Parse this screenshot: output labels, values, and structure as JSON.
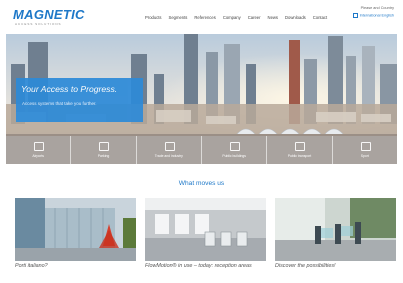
{
  "logo": {
    "text": "MAGNETIC",
    "tagline": "ACCESS SOLUTIONS"
  },
  "nav": [
    "Products",
    "Segments",
    "References",
    "Company",
    "Career",
    "News",
    "Downloads",
    "Contact"
  ],
  "utility": {
    "search_contact": "Please and Country",
    "language": "International English"
  },
  "hero": {
    "headline": "Your Access to Progress.",
    "subline": "Access systems that take you further."
  },
  "categories": [
    "Airports",
    "Parking",
    "Trade and industry",
    "Public buildings",
    "Public transport",
    "Sport"
  ],
  "section_title": "What moves us",
  "cards": [
    {
      "caption": "Porti italiano?"
    },
    {
      "caption": "FlowMotion® in use – today: reception areas"
    },
    {
      "caption": "Discover the possibilities!"
    }
  ],
  "colors": {
    "brand_blue": "#1e78c8",
    "logo_navy": "#1d3d8f",
    "claim_bg": "#2c8ad8"
  }
}
